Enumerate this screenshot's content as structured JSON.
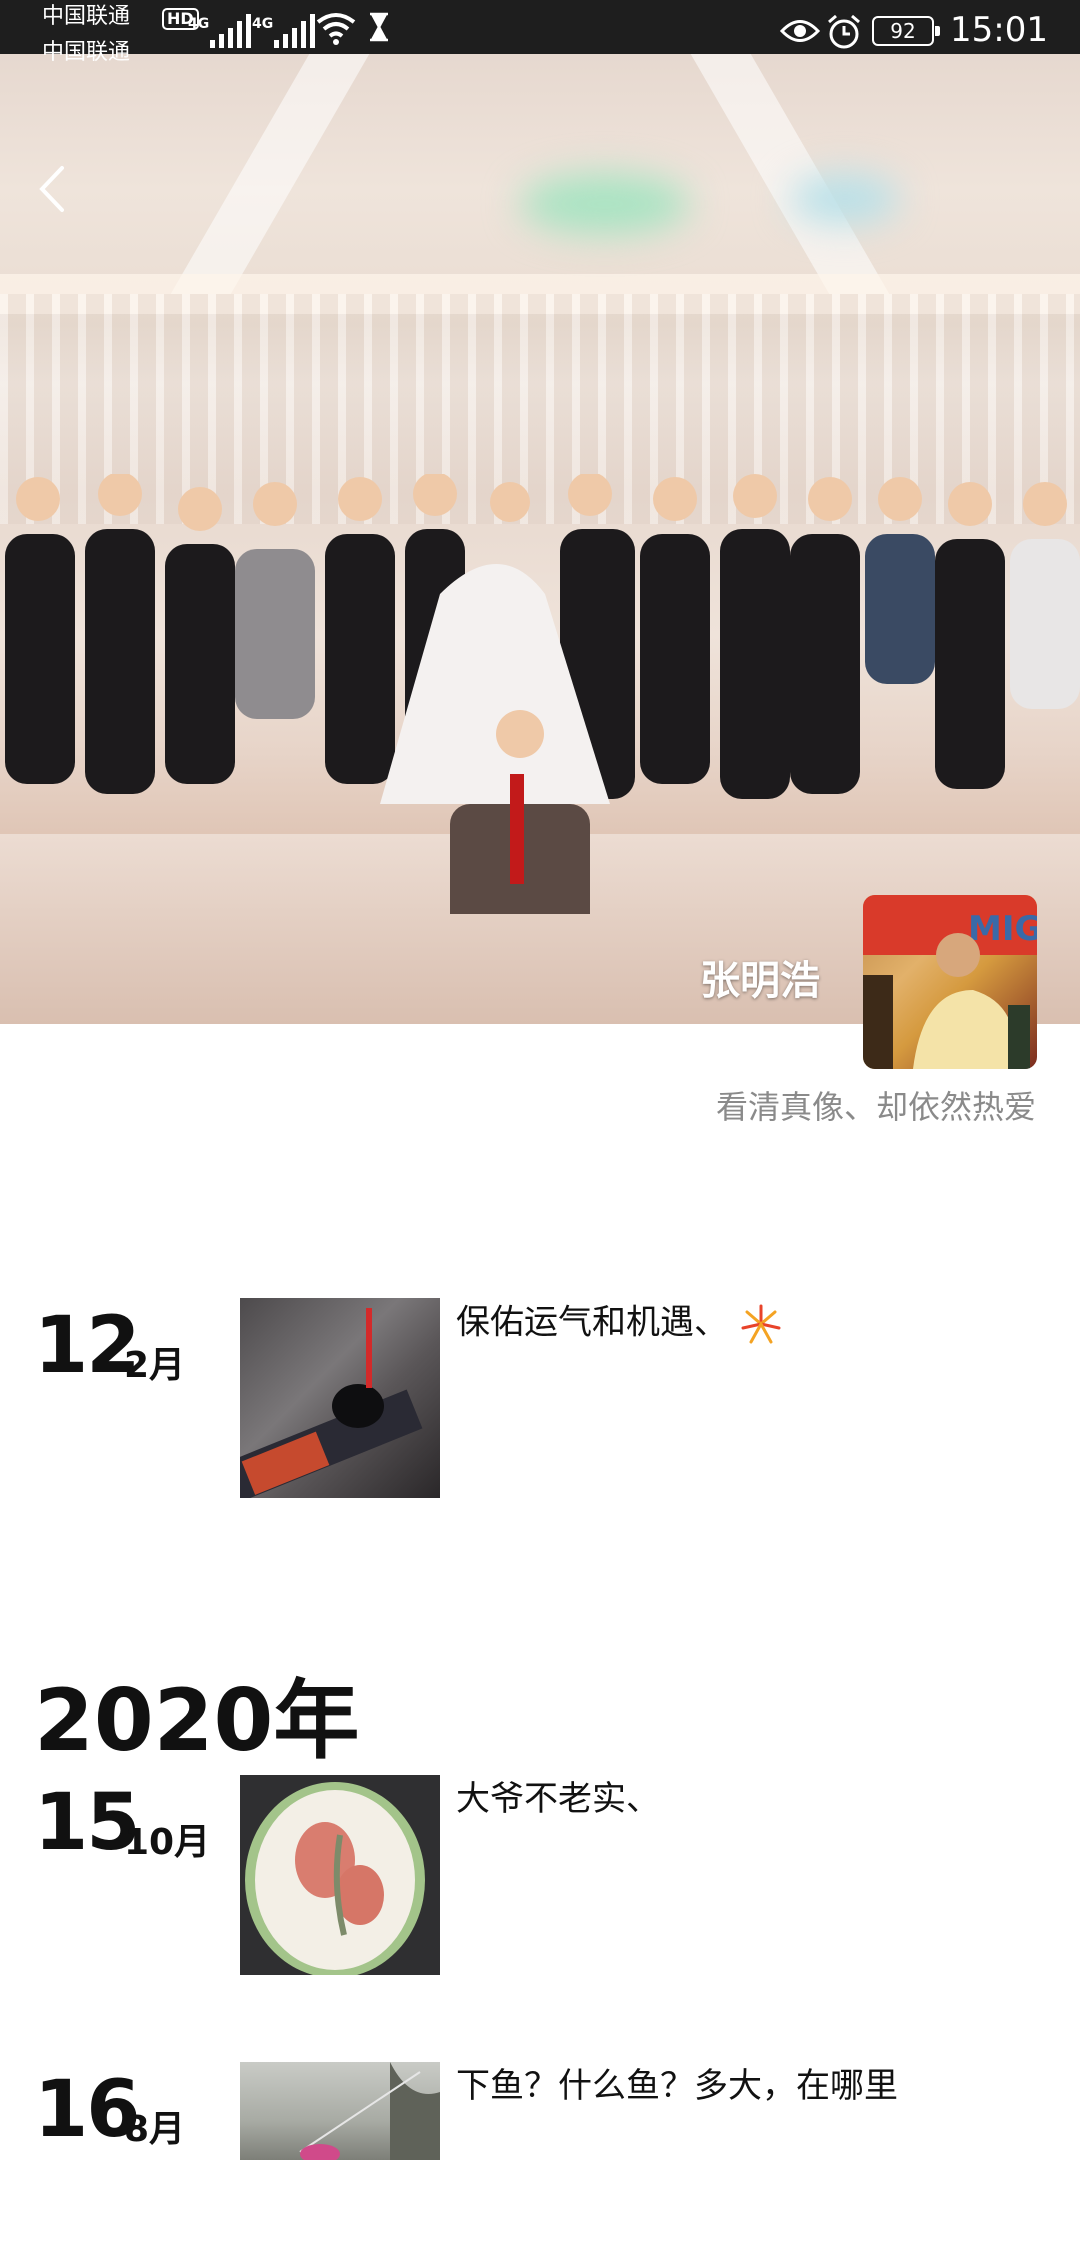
{
  "status_bar": {
    "carrier_1": "中国联通",
    "carrier_2": "中国联通",
    "hd_badge": "HD",
    "network_1": "4G",
    "network_2": "4G",
    "battery": "92",
    "time": "15:01"
  },
  "profile": {
    "username": "张明浩",
    "signature": "看清真像、却依然热爱"
  },
  "feed": {
    "posts": [
      {
        "day": "12",
        "month": "2月",
        "text": "保佑运气和机遇、"
      },
      {
        "day": "15",
        "month": "10月",
        "text": "大爷不老实、"
      },
      {
        "day": "16",
        "month": "8月",
        "text": "下鱼？什么鱼？多大，在哪里"
      }
    ],
    "year_heading": "2020年"
  },
  "icons": {
    "back": "chevron-left-icon",
    "firework": "firework-emoji-icon"
  },
  "colors": {
    "status_bar_bg": "#1e1e1e",
    "signature": "#8a8a8a",
    "text": "#111111"
  }
}
